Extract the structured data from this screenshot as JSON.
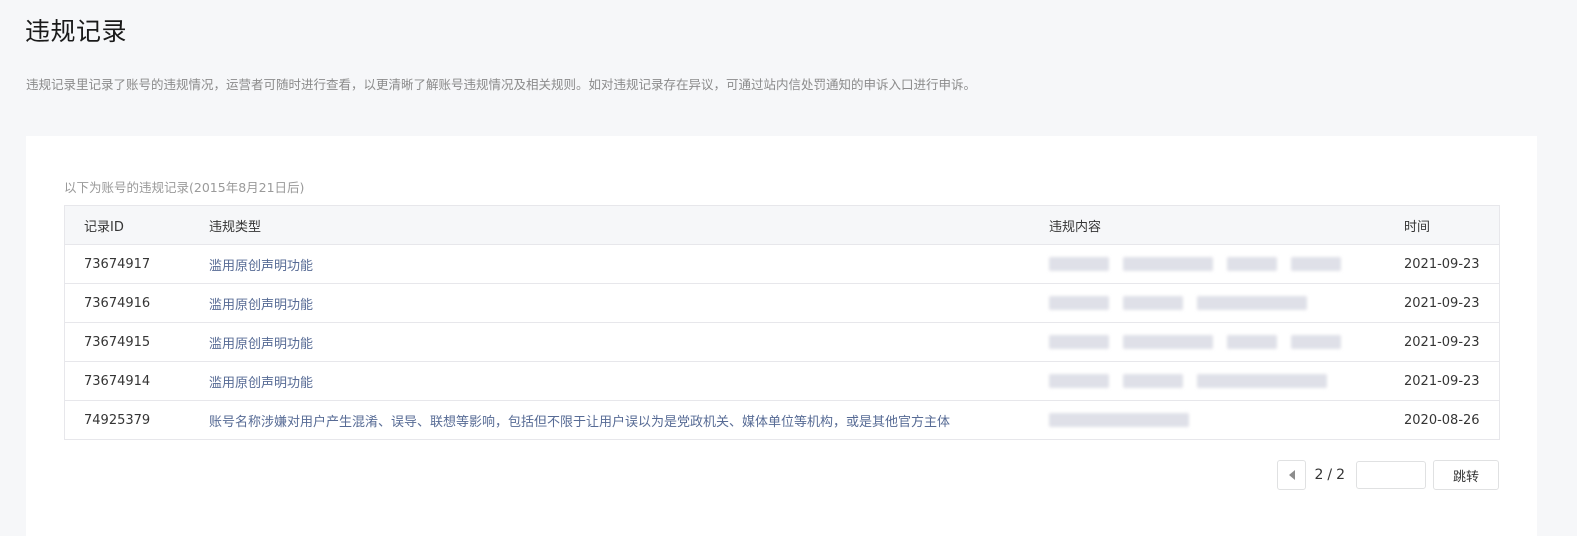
{
  "page": {
    "title": "违规记录",
    "description": "违规记录里记录了账号的违规情况，运营者可随时进行查看，以更清晰了解账号违规情况及相关规则。如对违规记录存在异议，可通过站内信处罚通知的申诉入口进行申诉。"
  },
  "panel": {
    "caption": "以下为账号的违规记录(2015年8月21日后)"
  },
  "table": {
    "headers": {
      "id": "记录ID",
      "type": "违规类型",
      "content": "违规内容",
      "time": "时间"
    },
    "rows": [
      {
        "id": "73674917",
        "type": "滥用原创声明功能",
        "time": "2021-09-23"
      },
      {
        "id": "73674916",
        "type": "滥用原创声明功能",
        "time": "2021-09-23"
      },
      {
        "id": "73674915",
        "type": "滥用原创声明功能",
        "time": "2021-09-23"
      },
      {
        "id": "73674914",
        "type": "滥用原创声明功能",
        "time": "2021-09-23"
      },
      {
        "id": "74925379",
        "type": "账号名称涉嫌对用户产生混淆、误导、联想等影响，包括但不限于让用户误以为是党政机关、媒体单位等机构，或是其他官方主体",
        "time": "2020-08-26"
      }
    ]
  },
  "pager": {
    "current": "2",
    "separator": "/",
    "total": "2",
    "input_value": "",
    "go_label": "跳转"
  },
  "colors": {
    "type_link": "#576b95",
    "background": "#f6f7f9"
  }
}
